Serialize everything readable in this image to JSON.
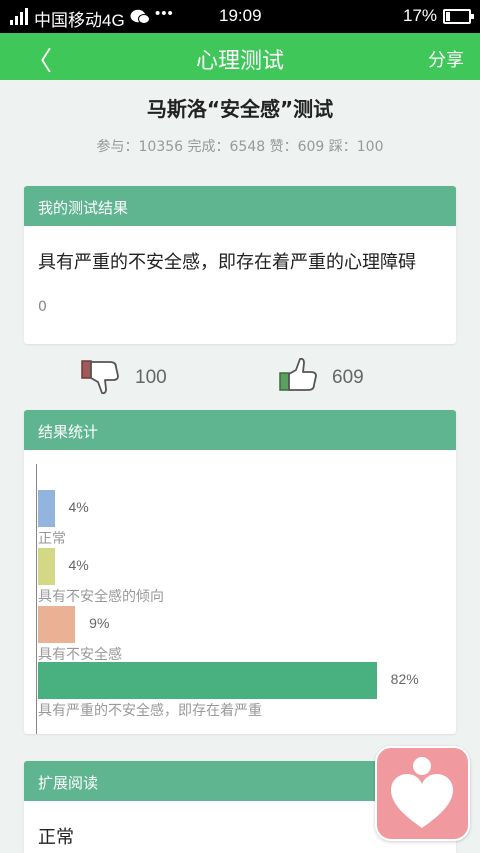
{
  "status_bar": {
    "network": "4G",
    "carrier": "中国移动4G",
    "time": "19:09",
    "battery": "17%"
  },
  "nav": {
    "back_icon": "chevron-left-icon",
    "title": "心理测试",
    "share": "分享"
  },
  "test": {
    "title": "马斯洛“安全感”测试",
    "stats": "参与：10356 完成：6548 赞：609 踩：100"
  },
  "result": {
    "header": "我的测试结果",
    "text": "具有严重的不安全感，即存在着严重的心理障碍",
    "score": "0"
  },
  "votes": {
    "dislike_count": "100",
    "like_count": "609"
  },
  "stats_section": {
    "header": "结果统计"
  },
  "chart_data": {
    "type": "bar",
    "orientation": "horizontal",
    "categories": [
      "正常",
      "具有不安全感的倾向",
      "具有不安全感",
      "具有严重的不安全感，即存在着严重"
    ],
    "values": [
      4,
      4,
      9,
      82
    ],
    "value_labels": [
      "4%",
      "4%",
      "9%",
      "82%"
    ],
    "colors": [
      "#92b4dd",
      "#d3d885",
      "#eab194",
      "#49b07f"
    ],
    "xlim": [
      0,
      100
    ]
  },
  "reading": {
    "header": "扩展阅读",
    "item": "正常"
  },
  "colors": {
    "nav_green": "#3fc75a",
    "header_green": "#5fb58f",
    "float_pink": "#f09aa0"
  }
}
